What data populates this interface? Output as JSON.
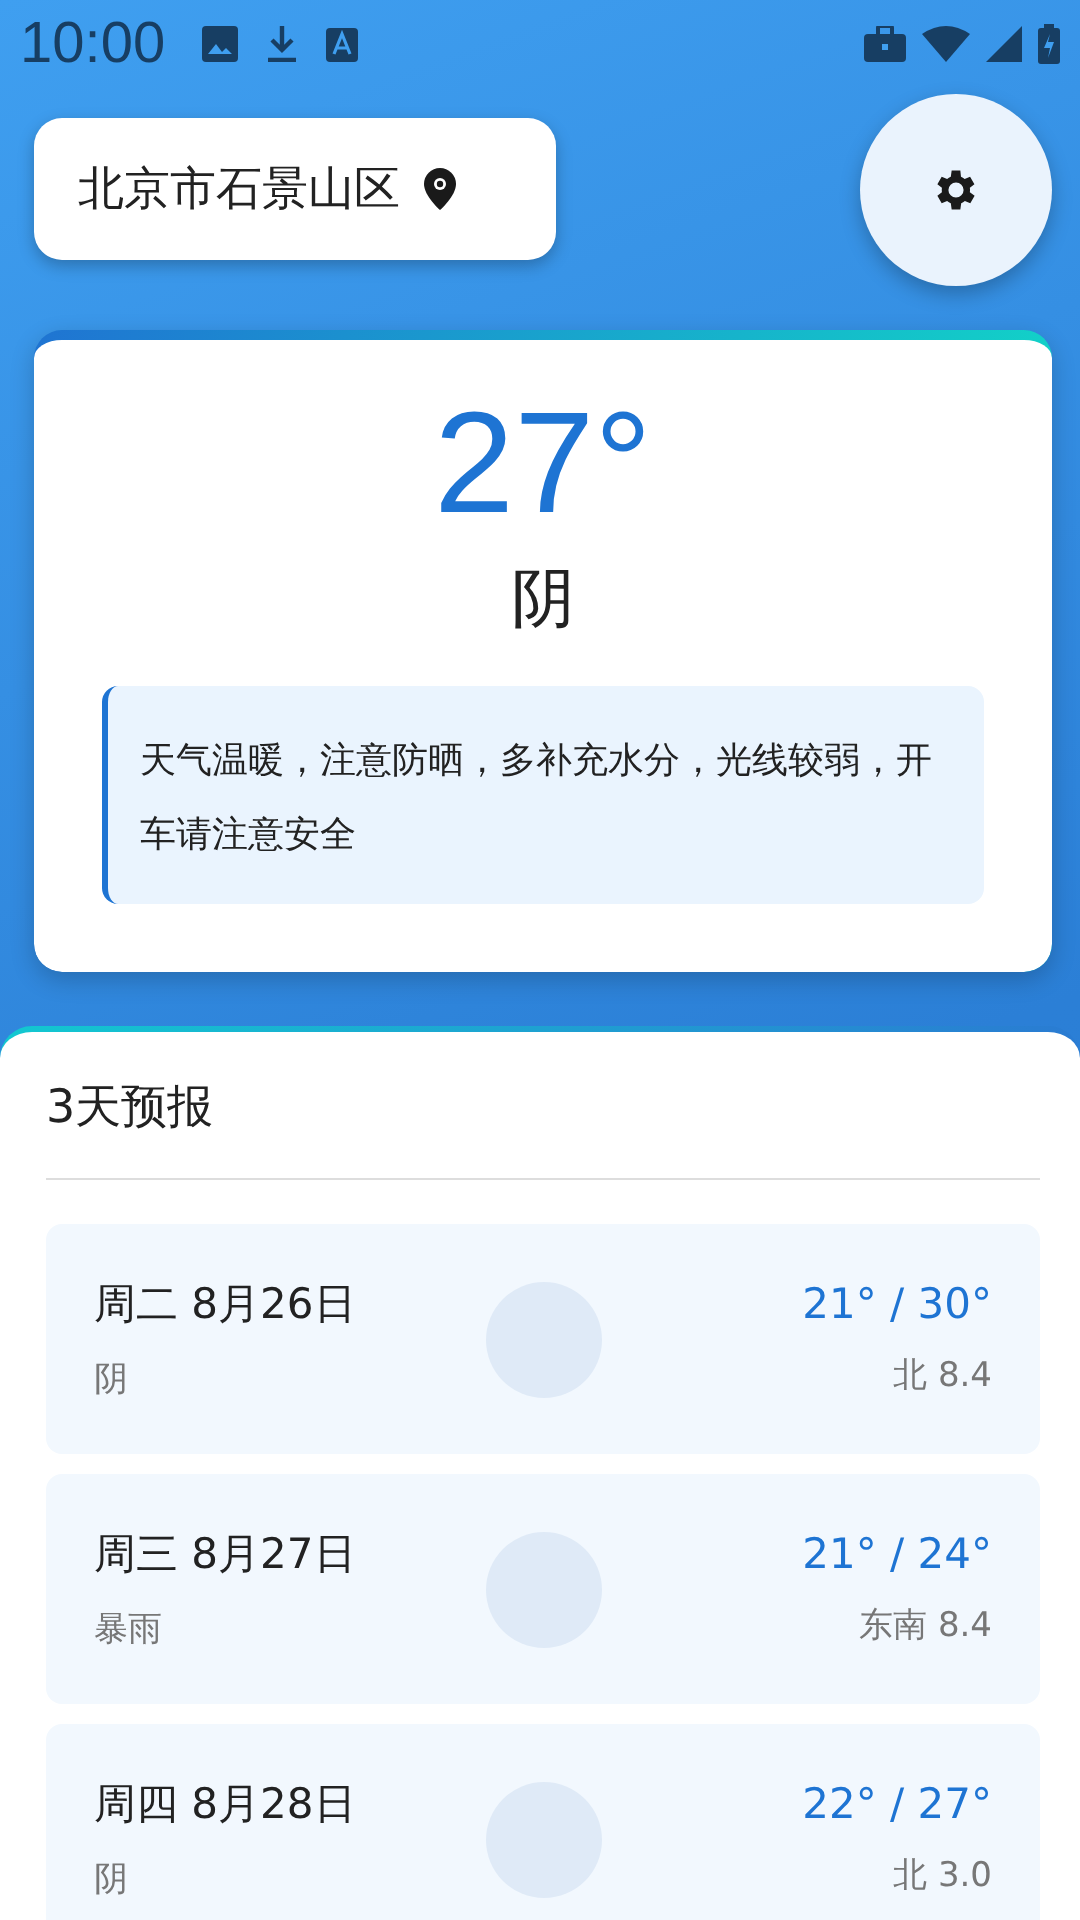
{
  "status_bar": {
    "time": "10:00"
  },
  "location": {
    "name": "北京市石景山区"
  },
  "current": {
    "temperature": "27°",
    "condition": "阴",
    "advice": "天气温暖，注意防晒，多补充水分，光线较弱，开车请注意安全"
  },
  "forecast": {
    "title": "3天预报",
    "days": [
      {
        "date": "周二 8月26日",
        "condition": "阴",
        "temps": "21° / 30°",
        "wind": "北 8.4"
      },
      {
        "date": "周三 8月27日",
        "condition": "暴雨",
        "temps": "21° / 24°",
        "wind": "东南 8.4"
      },
      {
        "date": "周四 8月28日",
        "condition": "阴",
        "temps": "22° / 27°",
        "wind": "北 3.0"
      }
    ]
  }
}
